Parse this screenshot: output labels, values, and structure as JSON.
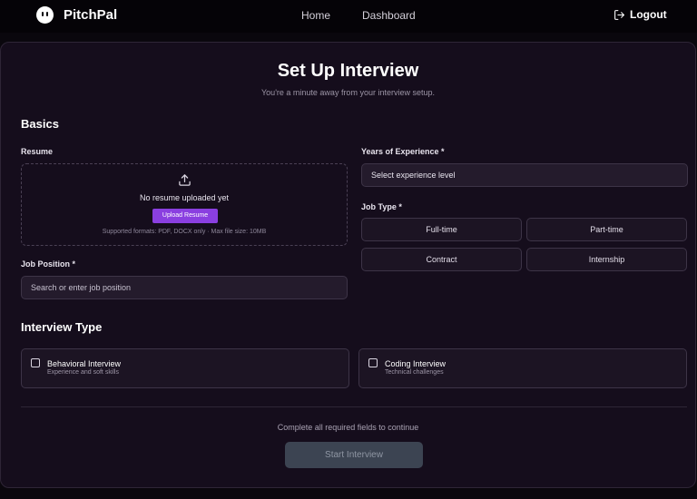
{
  "nav": {
    "brand": "PitchPal",
    "links": [
      {
        "label": "Home"
      },
      {
        "label": "Dashboard"
      }
    ],
    "logout_label": "Logout"
  },
  "form": {
    "title": "Set Up Interview",
    "subtitle": "You're a minute away from your interview setup.",
    "basics": {
      "heading": "Basics",
      "resume_label": "Resume",
      "upload_status": "No resume uploaded yet",
      "upload_button": "Upload Resume",
      "upload_hint": "Supported formats: PDF, DOCX only · Max file size: 10MB",
      "job_position_label": "Job Position *",
      "job_position_placeholder": "Search or enter job position",
      "experience_label": "Years of Experience *",
      "experience_value": "Select experience level",
      "job_type_label": "Job Type *",
      "job_types": [
        "Full-time",
        "Part-time",
        "Contract",
        "Internship"
      ]
    },
    "interview_type": {
      "heading": "Interview Type",
      "options": [
        {
          "name": "Behavioral Interview",
          "desc": "Experience and soft skills",
          "checked": false
        },
        {
          "name": "Coding Interview",
          "desc": "Technical challenges",
          "checked": false
        }
      ]
    },
    "footer_note": "Complete all required fields to continue",
    "start_button": "Start Interview"
  },
  "colors": {
    "accent": "#8a3fe0",
    "card_bg": "#150d1c",
    "page_bg": "#0a070d",
    "disabled_button": "#3c4452"
  },
  "icons": {
    "logo": "ghost-face-icon",
    "logout": "logout-icon",
    "upload": "upload-icon"
  }
}
